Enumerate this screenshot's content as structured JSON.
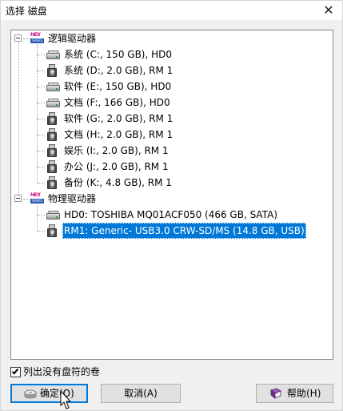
{
  "window": {
    "title": "选择 磁盘",
    "close_symbol": "✕"
  },
  "tree": {
    "groups": [
      {
        "label": "逻辑驱动器",
        "icon": "hex-icon",
        "icon_text_top": "HEX",
        "icon_text_bottom": "SAVES",
        "items": [
          {
            "label": "系统 (C:, 150 GB), HD0",
            "icon": "hdd-icon"
          },
          {
            "label": "系统 (D:, 2.0 GB), RM 1",
            "icon": "usb-icon"
          },
          {
            "label": "软件 (E:, 150 GB), HD0",
            "icon": "hdd-icon"
          },
          {
            "label": "文档 (F:, 166 GB), HD0",
            "icon": "hdd-icon"
          },
          {
            "label": "软件 (G:, 2.0 GB), RM 1",
            "icon": "usb-icon"
          },
          {
            "label": "文档 (H:, 2.0 GB), RM 1",
            "icon": "usb-icon"
          },
          {
            "label": "娱乐 (I:, 2.0 GB), RM 1",
            "icon": "usb-icon"
          },
          {
            "label": "办公 (J:, 2.0 GB), RM 1",
            "icon": "usb-icon"
          },
          {
            "label": "备份 (K:, 4.8 GB), RM 1",
            "icon": "usb-icon"
          }
        ]
      },
      {
        "label": "物理驱动器",
        "icon": "hex-icon",
        "icon_text_top": "HEX",
        "icon_text_bottom": "SAVES",
        "items": [
          {
            "label": "HD0: TOSHIBA MQ01ACF050 (466 GB, SATA)",
            "icon": "hdd-icon"
          },
          {
            "label": "RM1: Generic- USB3.0 CRW-SD/MS (14.8 GB, USB)",
            "icon": "usb-icon",
            "selected": true
          }
        ]
      }
    ]
  },
  "options": {
    "list_unlettered_label": "列出没有盘符的卷",
    "list_unlettered_checked": true
  },
  "buttons": {
    "ok_label": "确定(O)",
    "cancel_label": "取消(A)",
    "help_label": "帮助(H)"
  },
  "colors": {
    "selection": "#0078d7",
    "default_button_border": "#0078d7"
  }
}
